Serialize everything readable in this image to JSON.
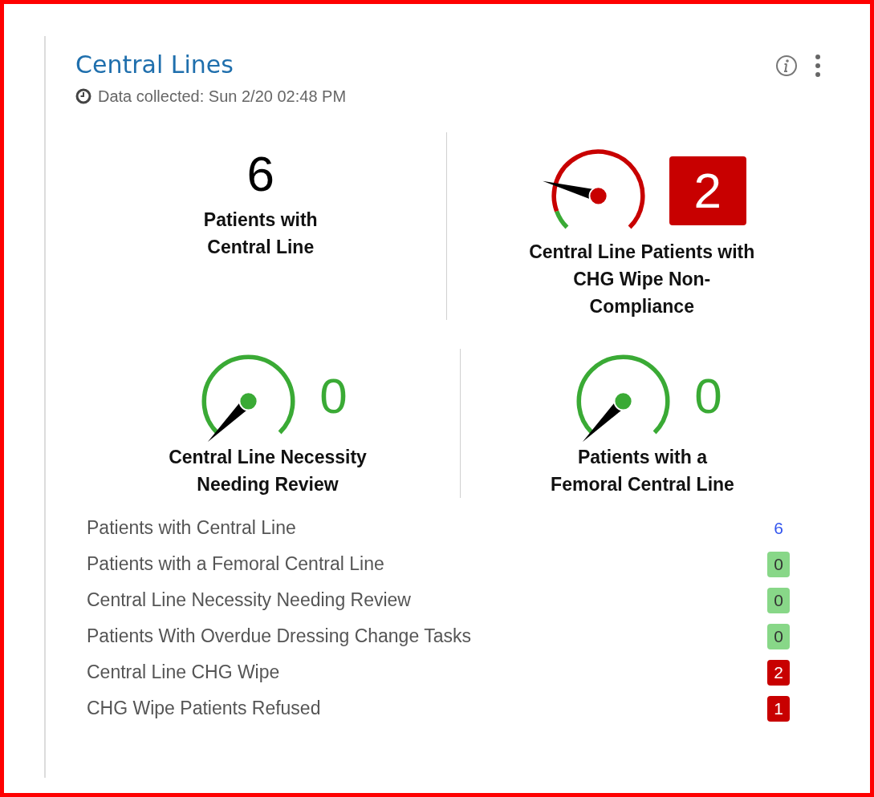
{
  "card": {
    "title": "Central Lines",
    "collected": "Data collected: Sun 2/20 02:48 PM"
  },
  "tiles": [
    {
      "kind": "number",
      "value": "6",
      "label": "Patients with Central Line"
    },
    {
      "kind": "alert_gauge",
      "color": "#c80000",
      "value": "2",
      "label": "Central Line Patients with CHG Wipe Non-Compliance"
    },
    {
      "kind": "gauge",
      "color": "#3aaa35",
      "value": "0",
      "label": "Central Line Necessity Needing Review"
    },
    {
      "kind": "gauge",
      "color": "#3aaa35",
      "value": "0",
      "label": "Patients with a Femoral Central Line"
    }
  ],
  "rows": [
    {
      "kind": "number",
      "label": "Patients with Central Line",
      "value": "6",
      "color": "#3355ee"
    },
    {
      "kind": "badge",
      "label": "Patients with a Femoral Central Line",
      "value": "0",
      "color": "#88d788"
    },
    {
      "kind": "badge",
      "label": "Central Line Necessity Needing Review",
      "value": "0",
      "color": "#88d788"
    },
    {
      "kind": "badge",
      "label": "Patients With Overdue Dressing Change Tasks",
      "value": "0",
      "color": "#88d788"
    },
    {
      "kind": "alert_badge",
      "label": "Central Line CHG Wipe",
      "value": "2",
      "color": "#c80000"
    },
    {
      "kind": "alert_badge",
      "label": "CHG Wipe Patients Refused",
      "value": "1",
      "color": "#c80000"
    }
  ]
}
